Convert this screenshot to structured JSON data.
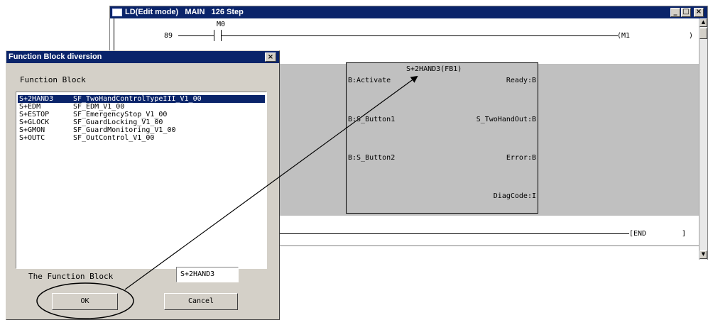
{
  "ld_window": {
    "title": "LD(Edit mode)   MAIN   126 Step",
    "controls": {
      "minimize": "_",
      "maximize": "□",
      "close": "×"
    },
    "rungs": [
      {
        "step": "89",
        "contact": "M0",
        "coil": "(M1",
        "coil_end": ")"
      },
      {
        "coil": "[END",
        "coil_end": "]"
      }
    ],
    "function_block": {
      "name": "S+2HAND3(FB1)",
      "inputs": [
        "B:Activate",
        "B:S_Button1",
        "B:S_Button2"
      ],
      "outputs": [
        "Ready:B",
        "S_TwoHandOut:B",
        "Error:B",
        "DiagCode:I"
      ]
    },
    "scrollbar": {
      "up": "▲",
      "down": "▼"
    }
  },
  "dialog": {
    "title": "Function Block diversion",
    "close": "×",
    "list_label": "Function Block",
    "items": [
      {
        "name": "S+2HAND3",
        "fb": "SF_TwoHandControlTypeIII_V1_00",
        "selected": true
      },
      {
        "name": "S+EDM",
        "fb": "SF_EDM_V1_00"
      },
      {
        "name": "S+ESTOP",
        "fb": "SF_EmergencyStop_V1_00"
      },
      {
        "name": "S+GLOCK",
        "fb": "SF_GuardLocking_V1_00"
      },
      {
        "name": "S+GMON",
        "fb": "SF_GuardMonitoring_V1_00"
      },
      {
        "name": "S+OUTC",
        "fb": "SF_OutControl_V1_00"
      }
    ],
    "fb_field_label": "The Function Block",
    "fb_field_value": "S+2HAND3",
    "ok_label": "OK",
    "cancel_label": "Cancel"
  },
  "colors": {
    "titlebar": "#0a246a",
    "dialog_bg": "#d4d0c8",
    "ladder_band": "#c0c0c0"
  }
}
